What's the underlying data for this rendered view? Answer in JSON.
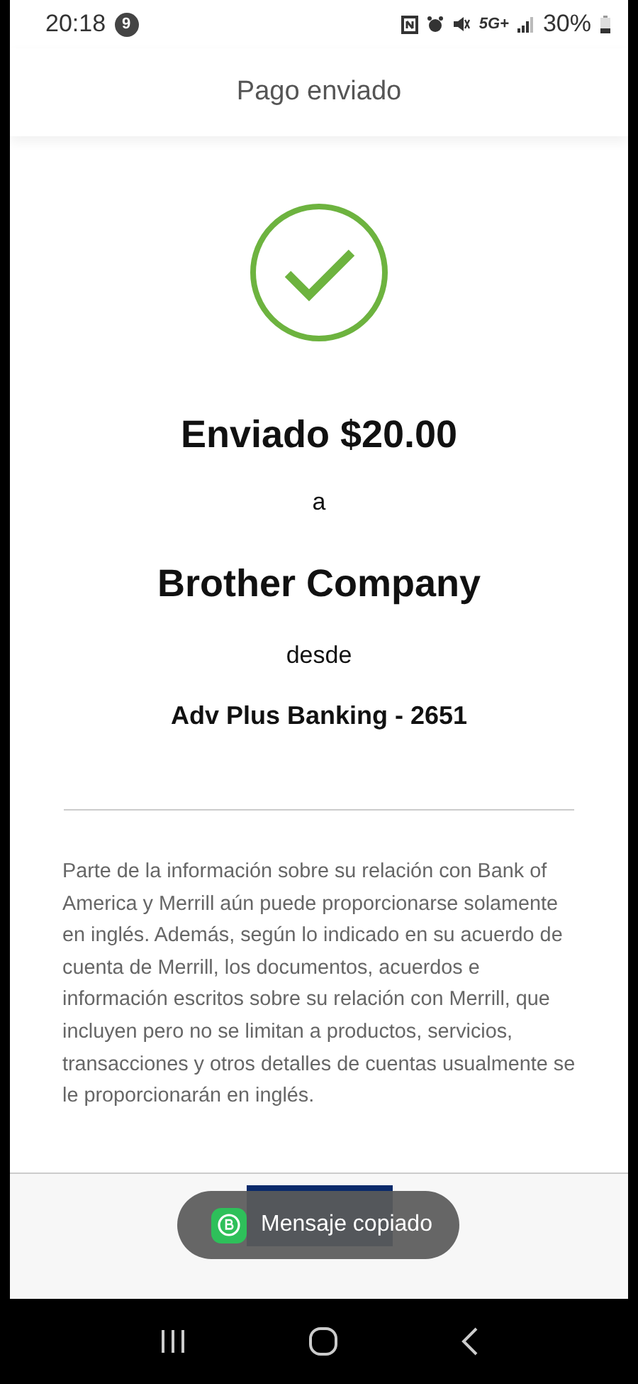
{
  "status_bar": {
    "time": "20:18",
    "notification_count": "9",
    "network": "5G+",
    "battery": "30%"
  },
  "header": {
    "title": "Pago enviado"
  },
  "confirmation": {
    "amount_line": "Enviado $20.00",
    "connector_to": "a",
    "recipient": "Brother Company",
    "connector_from": "desde",
    "account": "Adv Plus Banking - 2651"
  },
  "disclaimer": "Parte de la información sobre su relación con Bank of America y Merrill aún puede proporcionarse solamente en inglés. Además, según lo indicado en su acuerdo de cuenta de Merrill, los documentos, acuerdos e información escritos sobre su relación con Merrill, que incluyen pero no se limitan a productos, servicios, transacciones y otros detalles de cuentas usualmente se le proporcionarán en inglés.",
  "toast": {
    "message": "Mensaje copiado"
  }
}
